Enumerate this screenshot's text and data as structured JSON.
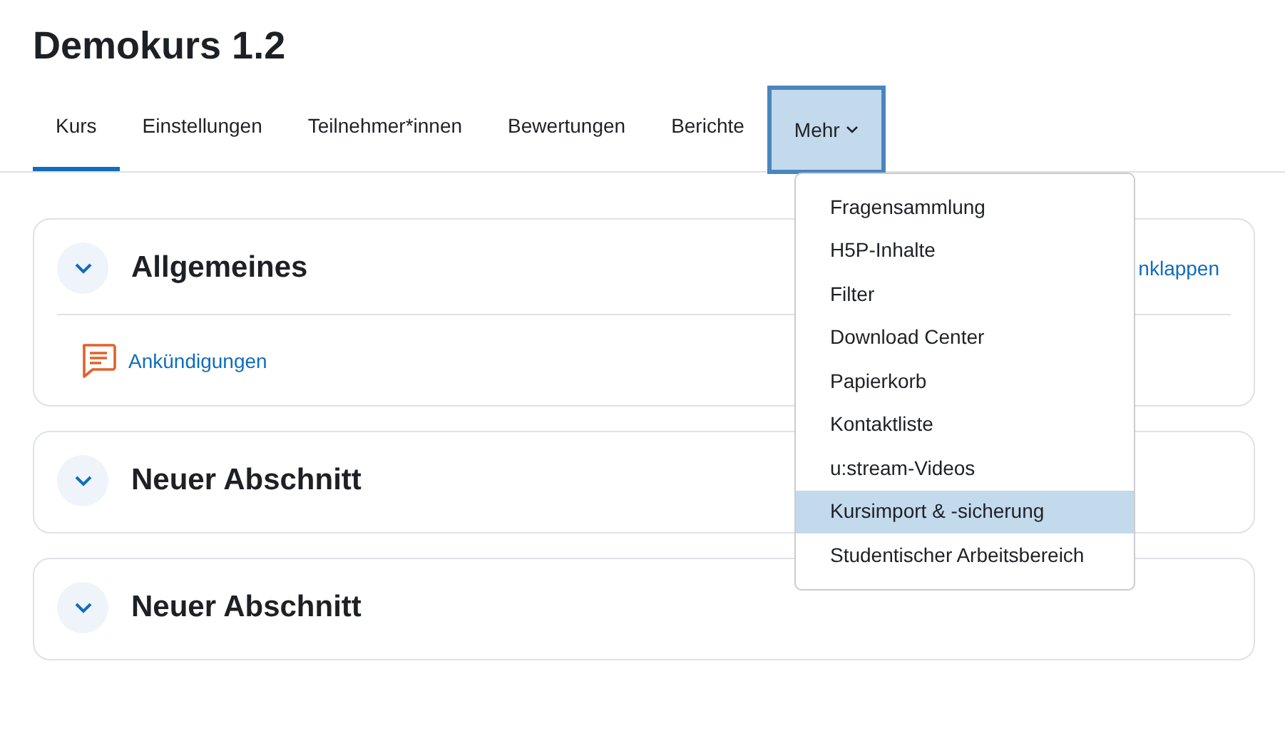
{
  "course_title": "Demokurs 1.2",
  "tabs": [
    {
      "label": "Kurs",
      "selected": true
    },
    {
      "label": "Einstellungen",
      "selected": false
    },
    {
      "label": "Teilnehmer*innen",
      "selected": false
    },
    {
      "label": "Bewertungen",
      "selected": false
    },
    {
      "label": "Berichte",
      "selected": false
    }
  ],
  "more_menu": {
    "label": "Mehr",
    "expanded": true,
    "items": [
      {
        "label": "Fragensammlung",
        "selected": false
      },
      {
        "label": "H5P-Inhalte",
        "selected": false
      },
      {
        "label": "Filter",
        "selected": false
      },
      {
        "label": "Download Center",
        "selected": false
      },
      {
        "label": "Papierkorb",
        "selected": false
      },
      {
        "label": "Kontaktliste",
        "selected": false
      },
      {
        "label": "u:stream-Videos",
        "selected": false
      },
      {
        "label": "Kursimport & -sicherung",
        "selected": true
      },
      {
        "label": "Studentischer Arbeitsbereich",
        "selected": false
      }
    ]
  },
  "sections": [
    {
      "title": "Allgemeines",
      "collapse_link": "nklappen",
      "activities": [
        {
          "name": "Ankündigungen"
        }
      ]
    },
    {
      "title": "Neuer Abschnitt"
    },
    {
      "title": "Neuer Abschnitt"
    }
  ]
}
